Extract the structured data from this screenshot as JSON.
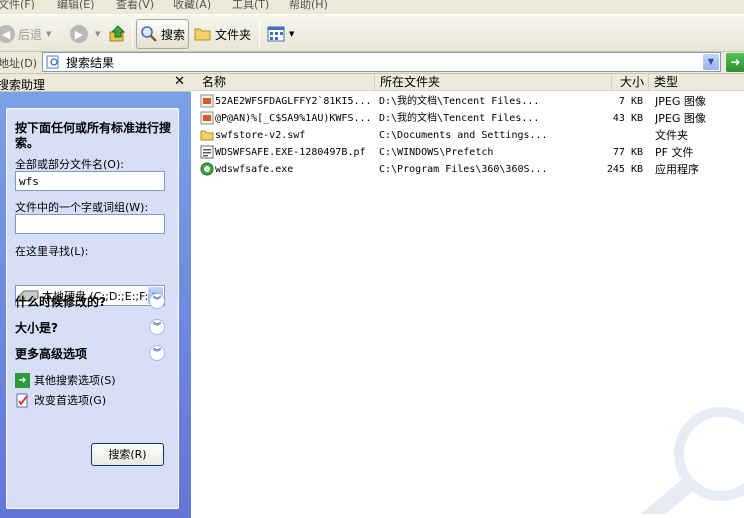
{
  "menu": [
    "文件(F)",
    "编辑(E)",
    "查看(V)",
    "收藏(A)",
    "工具(T)",
    "帮助(H)"
  ],
  "toolbar": {
    "back_label": "后退",
    "search_label": "搜索",
    "folders_label": "文件夹"
  },
  "address": {
    "label": "地址(D)",
    "value": "搜索结果"
  },
  "pane": {
    "title": "搜索助理",
    "heading": "按下面任何或所有标准进行搜索。",
    "filename_label": "全部或部分文件名(O):",
    "filename_value": "wfs",
    "phrase_label": "文件中的一个字或词组(W):",
    "phrase_value": "",
    "lookin_label": "在这里寻找(L):",
    "lookin_value": "本地硬盘 (C:;D:;E:;F:",
    "sections": [
      "什么时候修改的?",
      "大小是?",
      "更多高级选项"
    ],
    "links": [
      "其他搜索选项(S)",
      "改变首选项(G)"
    ],
    "search_button": "搜索(R)"
  },
  "columns": [
    "名称",
    "所在文件夹",
    "大小",
    "类型"
  ],
  "files": [
    {
      "name": "52AE2WFSFDAGLFFY2`81KI5...",
      "folder": "D:\\我的文档\\Tencent Files...",
      "size": "7 KB",
      "type": "JPEG 图像",
      "icon": "jpeg-icon"
    },
    {
      "name": "@P@AN)%[_C$SA9%1AU)KWFS...",
      "folder": "D:\\我的文档\\Tencent Files...",
      "size": "43 KB",
      "type": "JPEG 图像",
      "icon": "jpeg-icon"
    },
    {
      "name": "swfstore-v2.swf",
      "folder": "C:\\Documents and Settings...",
      "size": "",
      "type": "文件夹",
      "icon": "folder-icon"
    },
    {
      "name": "WDSWFSAFE.EXE-1280497B.pf",
      "folder": "C:\\WINDOWS\\Prefetch",
      "size": "77 KB",
      "type": "PF 文件",
      "icon": "pf-file-icon"
    },
    {
      "name": "wdswfsafe.exe",
      "folder": "C:\\Program Files\\360\\360S...",
      "size": "245 KB",
      "type": "应用程序",
      "icon": "exe-icon"
    }
  ]
}
